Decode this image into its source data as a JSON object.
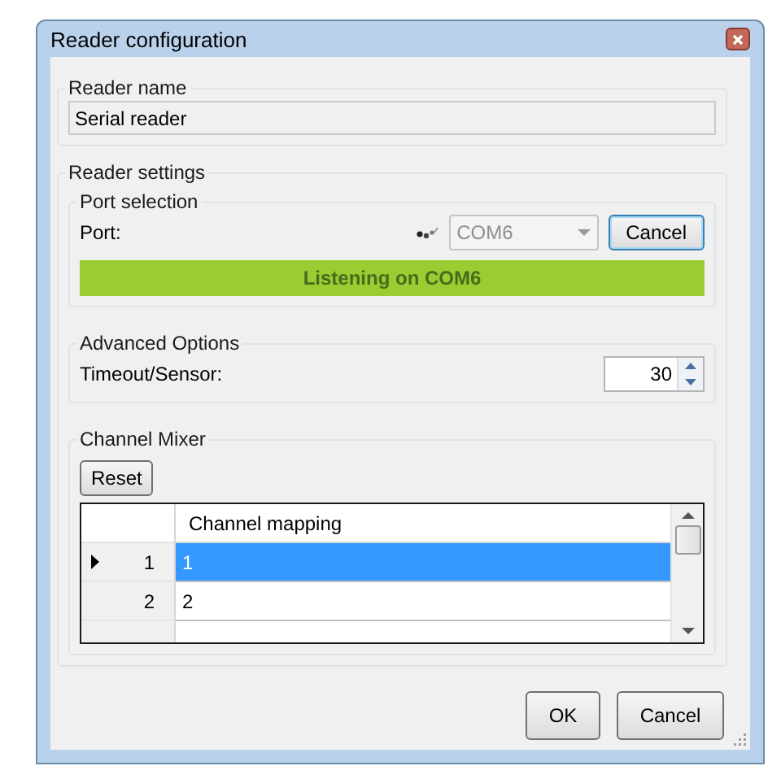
{
  "window": {
    "title": "Reader configuration"
  },
  "reader_name": {
    "legend": "Reader name",
    "value": "Serial reader"
  },
  "reader_settings": {
    "legend": "Reader settings",
    "port_selection": {
      "legend": "Port selection",
      "label": "Port:",
      "port": "COM6",
      "disabled": true,
      "cancel": "Cancel",
      "status": "Listening on COM6"
    },
    "advanced": {
      "legend": "Advanced Options",
      "label": "Timeout/Sensor:",
      "value": "30"
    },
    "channel_mixer": {
      "legend": "Channel Mixer",
      "reset": "Reset",
      "columns": [
        "Channel mapping"
      ],
      "rows": [
        {
          "index": "1",
          "mapping": "1",
          "selected": true
        },
        {
          "index": "2",
          "mapping": "2",
          "selected": false
        }
      ]
    }
  },
  "buttons": [
    "OK",
    "Cancel"
  ]
}
